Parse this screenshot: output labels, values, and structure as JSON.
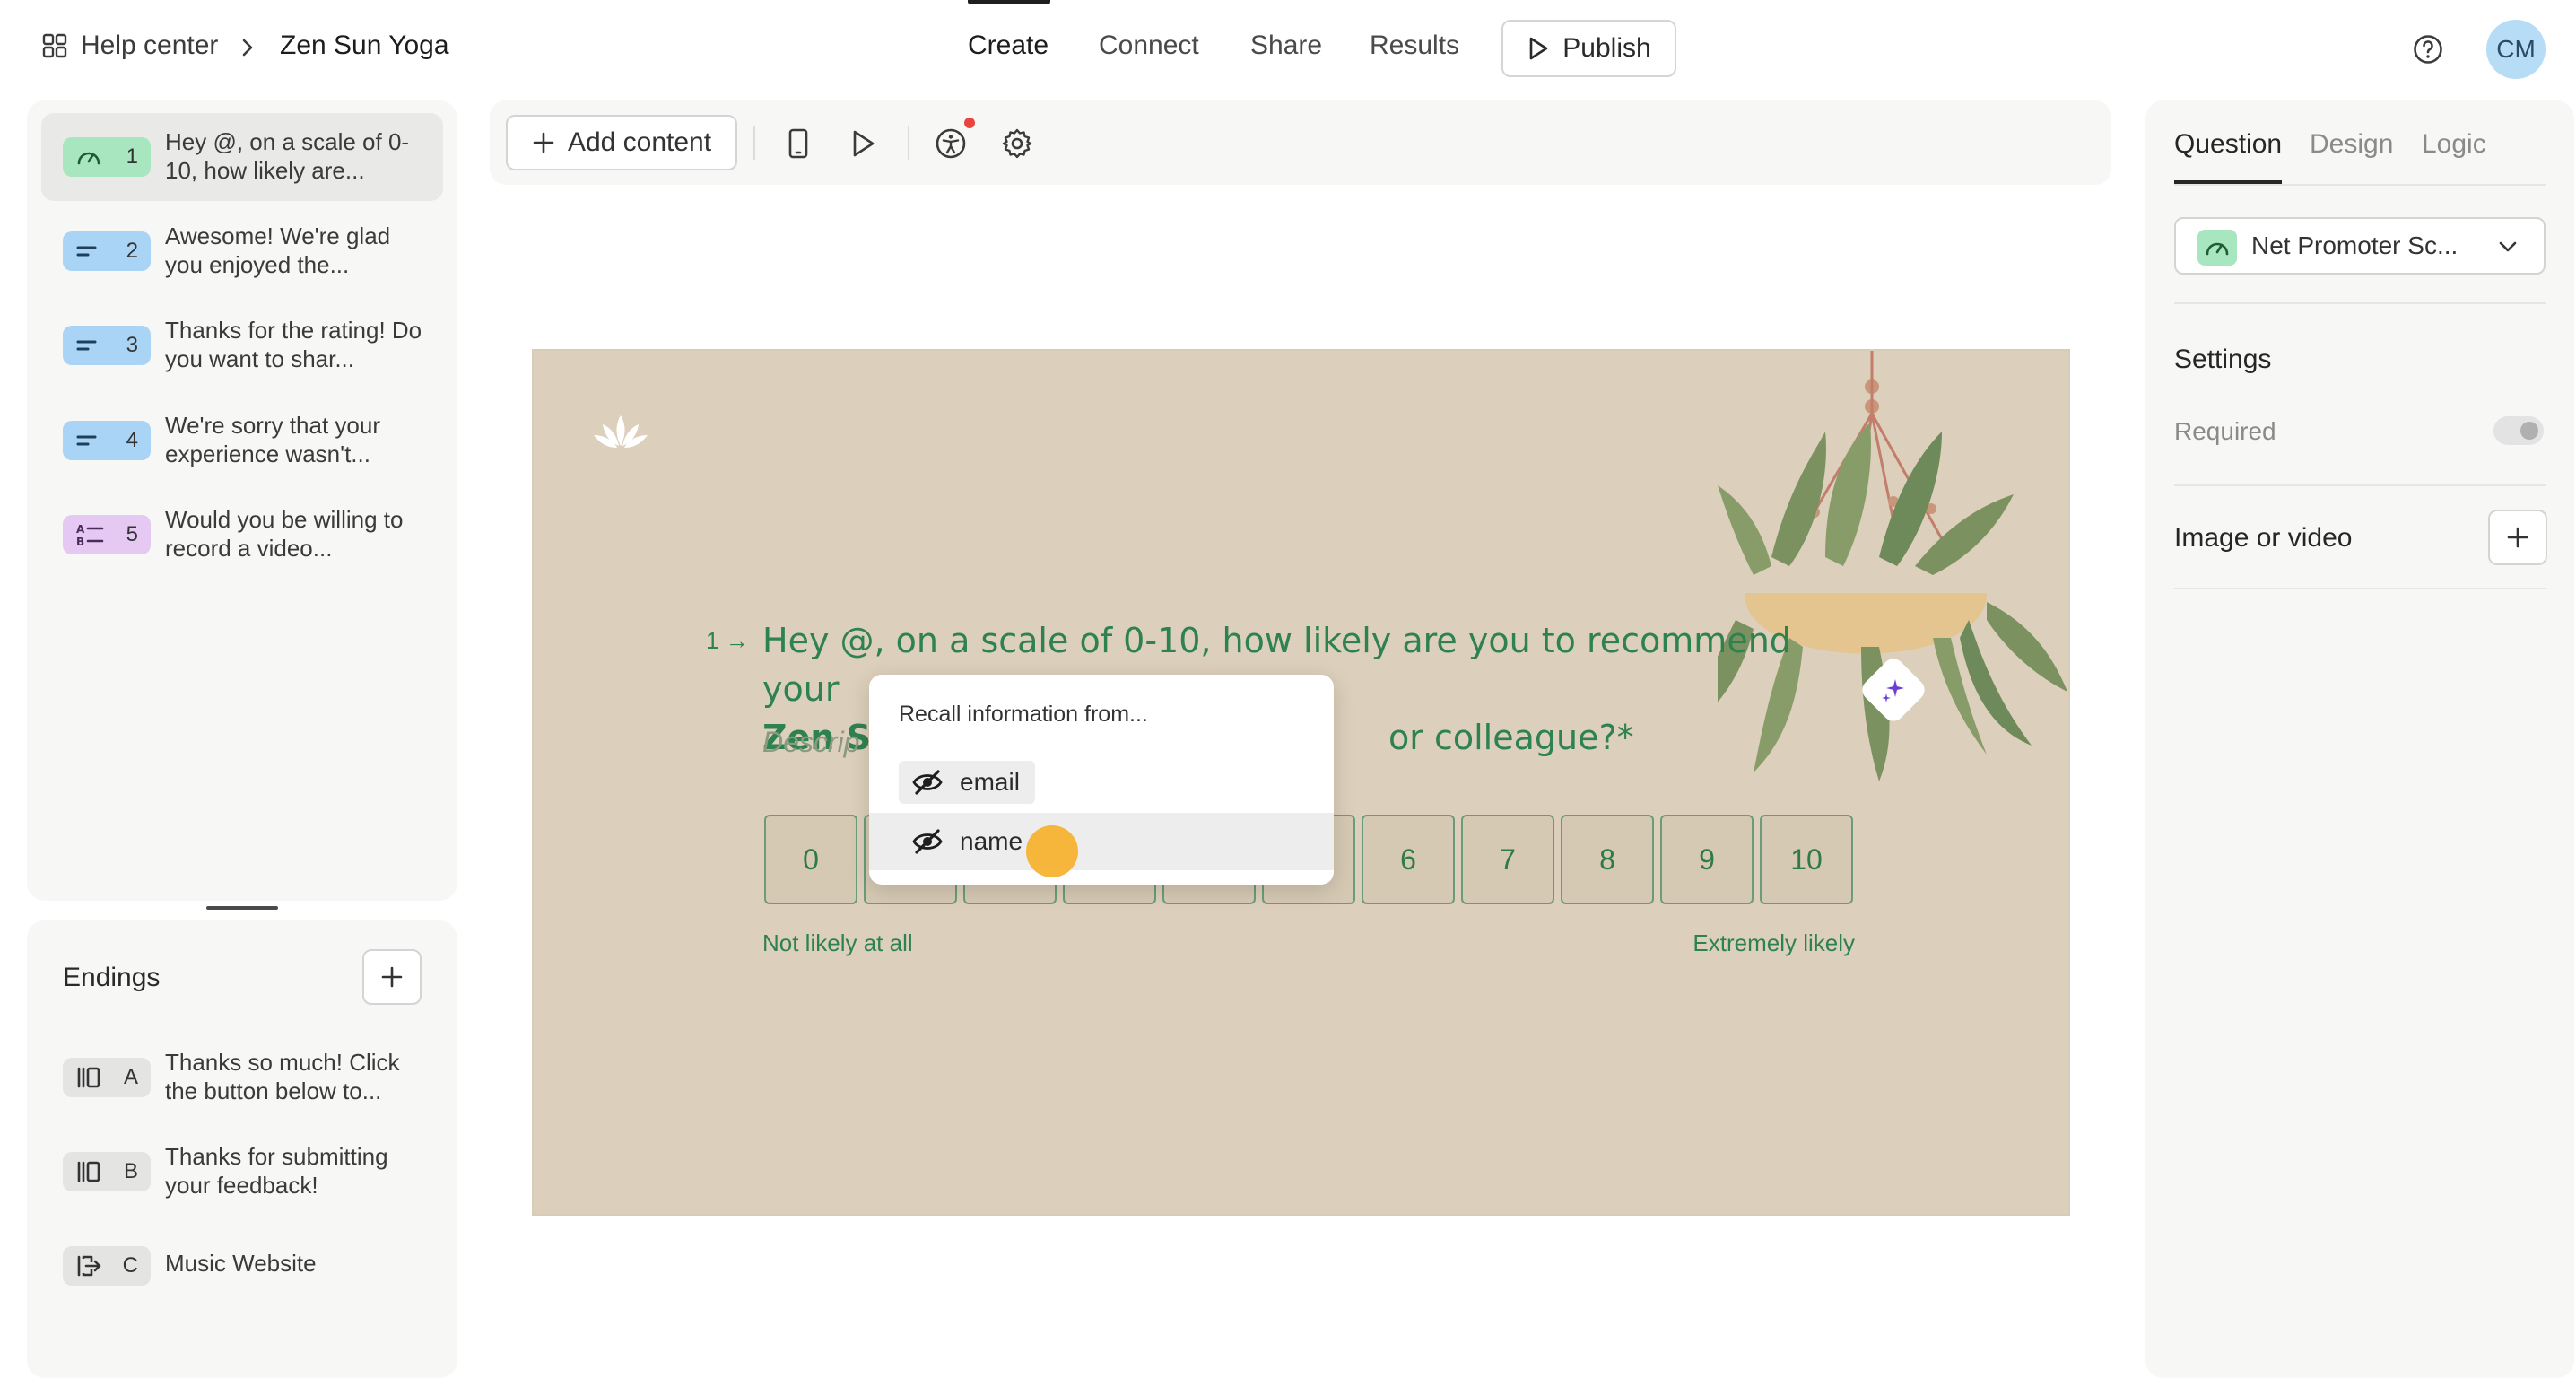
{
  "header": {
    "help_center": "Help center",
    "breadcrumb_current": "Zen Sun Yoga",
    "tabs": [
      {
        "label": "Create",
        "active": true
      },
      {
        "label": "Connect",
        "active": false
      },
      {
        "label": "Share",
        "active": false
      },
      {
        "label": "Results",
        "active": false
      }
    ],
    "publish_label": "Publish",
    "avatar_initials": "CM"
  },
  "questions": [
    {
      "number": "1",
      "text": "Hey @, on a scale of 0-10, how likely are...",
      "icon": "gauge-icon",
      "color": "#a8e6bf",
      "selected": true
    },
    {
      "number": "2",
      "text": "Awesome! We're glad you enjoyed the...",
      "icon": "short-text-icon",
      "color": "#a9d4f5",
      "selected": false
    },
    {
      "number": "3",
      "text": "Thanks for the rating! Do you want to shar...",
      "icon": "short-text-icon",
      "color": "#a9d4f5",
      "selected": false
    },
    {
      "number": "4",
      "text": "We're sorry that your experience wasn't...",
      "icon": "short-text-icon",
      "color": "#a9d4f5",
      "selected": false
    },
    {
      "number": "5",
      "text": "Would you be willing to record a video...",
      "icon": "multiple-choice-icon",
      "color": "#e6c9f3",
      "selected": false
    }
  ],
  "endings": {
    "title": "Endings",
    "items": [
      {
        "letter": "A",
        "text": "Thanks so much! Click the button below to...",
        "icon": "ending-screen-icon"
      },
      {
        "letter": "B",
        "text": "Thanks for submitting your feedback!",
        "icon": "ending-screen-icon"
      },
      {
        "letter": "C",
        "text": "Music Website",
        "icon": "redirect-icon"
      }
    ]
  },
  "toolbar": {
    "add_content_label": "Add content"
  },
  "canvas": {
    "question_number": "1",
    "question_part1": "Hey @, on a scale of 0-10, how likely are you to recommend your",
    "question_bold": "Zen Su",
    "question_tail": "or colleague?*",
    "description_placeholder": "Descrip",
    "scale_values": [
      "0",
      "1",
      "2",
      "3",
      "4",
      "5",
      "6",
      "7",
      "8",
      "9",
      "10"
    ],
    "low_label": "Not likely at all",
    "high_label": "Extremely likely",
    "background_color": "#dccfbb",
    "text_color": "#2e8250"
  },
  "recall_menu": {
    "title": "Recall information from...",
    "options": [
      {
        "label": "email",
        "icon": "eye-off-icon"
      },
      {
        "label": "name",
        "icon": "eye-off-icon"
      }
    ]
  },
  "right_panel": {
    "tabs": [
      {
        "label": "Question",
        "active": true
      },
      {
        "label": "Design",
        "active": false
      },
      {
        "label": "Logic",
        "active": false
      }
    ],
    "question_type": "Net Promoter Sc...",
    "settings_title": "Settings",
    "required_label": "Required",
    "required_on": false,
    "media_label": "Image or video"
  }
}
